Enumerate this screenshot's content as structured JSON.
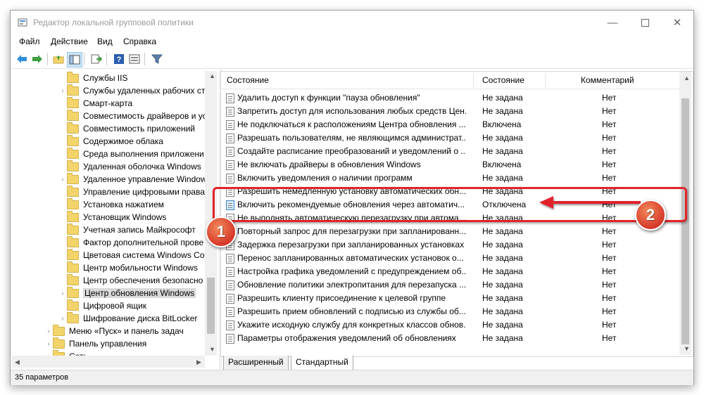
{
  "window": {
    "title": "Редактор локальной групповой политики"
  },
  "menu": [
    "Файл",
    "Действие",
    "Вид",
    "Справка"
  ],
  "toolbar": {
    "icons": [
      "back-arrow-icon",
      "forward-arrow-icon",
      "folder-up-icon",
      "show-hide-tree-icon",
      "export-list-icon",
      "help-icon",
      "properties-icon",
      "filter-icon"
    ]
  },
  "tree": {
    "items": [
      {
        "label": "Службы IIS",
        "expandable": false
      },
      {
        "label": "Службы удаленных рабочих ст",
        "expandable": true
      },
      {
        "label": "Смарт-карта",
        "expandable": false
      },
      {
        "label": "Совместимость драйверов и ус",
        "expandable": false
      },
      {
        "label": "Совместимость приложений",
        "expandable": false
      },
      {
        "label": "Содержимое облака",
        "expandable": false
      },
      {
        "label": "Среда выполнения приложени",
        "expandable": false
      },
      {
        "label": "Удаленная оболочка Windows",
        "expandable": false
      },
      {
        "label": "Удаленное управление Window",
        "expandable": true
      },
      {
        "label": "Управление цифровыми права",
        "expandable": false
      },
      {
        "label": "Установка нажатием",
        "expandable": false
      },
      {
        "label": "Установщик Windows",
        "expandable": false
      },
      {
        "label": "Учетная запись Майкрософт",
        "expandable": false
      },
      {
        "label": "Фактор дополнительной прове",
        "expandable": false
      },
      {
        "label": "Цветовая система Windows Col",
        "expandable": false
      },
      {
        "label": "Центр мобильности Windows",
        "expandable": false
      },
      {
        "label": "Центр обеспечения безопасно",
        "expandable": false
      },
      {
        "label": "Центр обновления Windows",
        "expandable": true,
        "selected": true
      },
      {
        "label": "Цифровой ящик",
        "expandable": false
      },
      {
        "label": "Шифрование диска BitLocker",
        "expandable": true
      },
      {
        "label": "Меню «Пуск» и панель задач",
        "expandable": true,
        "level": 0
      },
      {
        "label": "Панель управления",
        "expandable": true,
        "level": 0
      },
      {
        "label": "Сеть",
        "expandable": true,
        "level": 0
      }
    ]
  },
  "list": {
    "columns": [
      "Состояние",
      "Состояние",
      "Комментарий"
    ],
    "rows": [
      {
        "name": "Удалить доступ к функции \"пауза обновления\"",
        "state": "Не задана",
        "comment": "Нет"
      },
      {
        "name": "Запретить доступ для использования любых средств Цен...",
        "state": "Не задана",
        "comment": "Нет"
      },
      {
        "name": "Не подключаться к расположениям Центра обновления ...",
        "state": "Включена",
        "comment": "Нет"
      },
      {
        "name": "Разрешать пользователям, не являющимся администрат...",
        "state": "Не задана",
        "comment": "Нет"
      },
      {
        "name": "Создайте расписание преобразований и уведомлений о ...",
        "state": "Не задана",
        "comment": "Нет"
      },
      {
        "name": "Не включать драйверы в обновления Windows",
        "state": "Включена",
        "comment": "Нет"
      },
      {
        "name": "Включить уведомления о наличии программ",
        "state": "Не задана",
        "comment": "Нет"
      },
      {
        "name": "Разрешить немедленную установку автоматических обн...",
        "state": "Не задана",
        "comment": "Нет"
      },
      {
        "name": "Включить рекомендуемые обновления через автоматич...",
        "state": "Отключена",
        "comment": "Нет",
        "highlight": true
      },
      {
        "name": "Не выполнять автоматическую перезагрузку при автома...",
        "state": "Не задана",
        "comment": "Нет"
      },
      {
        "name": "Повторный запрос для перезагрузки при запланированн...",
        "state": "Не задана",
        "comment": "Нет"
      },
      {
        "name": "Задержка перезагрузки при запланированных установках",
        "state": "Не задана",
        "comment": "Нет"
      },
      {
        "name": "Перенос запланированных автоматических установок о...",
        "state": "Не задана",
        "comment": "Нет"
      },
      {
        "name": "Настройка графика уведомлений с предупреждением об...",
        "state": "Не задана",
        "comment": "Нет"
      },
      {
        "name": "Обновление политики электропитания для перезапуска ...",
        "state": "Не задана",
        "comment": "Нет"
      },
      {
        "name": "Разрешить клиенту присоединение к целевой группе",
        "state": "Не задана",
        "comment": "Нет"
      },
      {
        "name": "Разрешить прием обновлений с подписью из службы об...",
        "state": "Не задана",
        "comment": "Нет"
      },
      {
        "name": "Укажите исходную службу для конкретных классов обнов...",
        "state": "Не задана",
        "comment": "Нет"
      },
      {
        "name": "Параметры отображения уведомлений об обновлениях",
        "state": "Не задана",
        "comment": "Нет"
      }
    ]
  },
  "tabs": [
    "Расширенный",
    "Стандартный"
  ],
  "status": "35 параметров",
  "annotations": {
    "callout1": "1",
    "callout2": "2",
    "accent": "#e2232a"
  }
}
